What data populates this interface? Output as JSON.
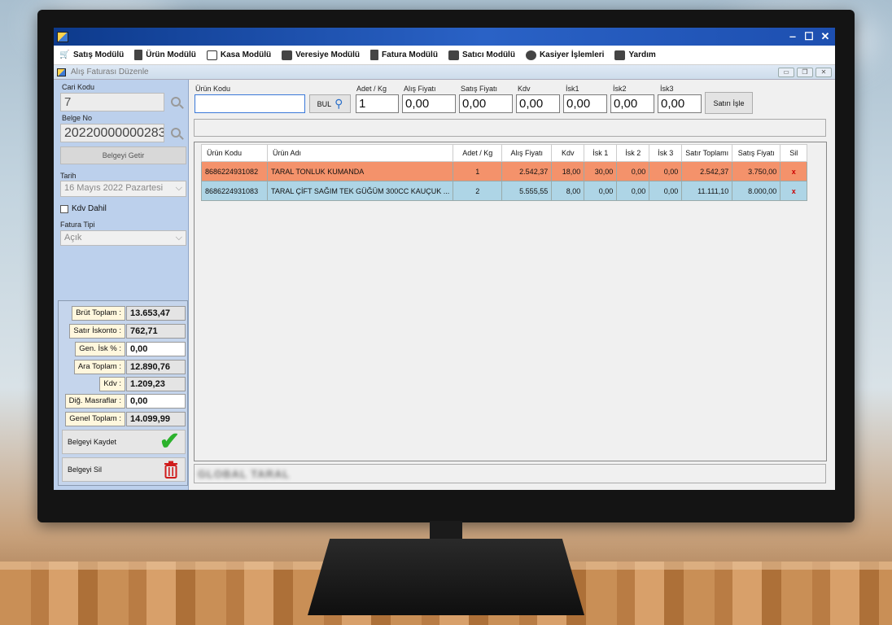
{
  "menu": {
    "items": [
      {
        "label": "Satış Modülü",
        "icon": "cart-icon"
      },
      {
        "label": "Ürün Modülü",
        "icon": "document-icon"
      },
      {
        "label": "Kasa Modülü",
        "icon": "cash-register-icon"
      },
      {
        "label": "Veresiye Modülü",
        "icon": "person-card-icon"
      },
      {
        "label": "Fatura Modülü",
        "icon": "document-icon"
      },
      {
        "label": "Satıcı Modülü",
        "icon": "person-card-icon"
      },
      {
        "label": "Kasiyer İşlemleri",
        "icon": "user-circle-icon"
      },
      {
        "label": "Yardım",
        "icon": "help-icon"
      }
    ]
  },
  "subwindow": {
    "title": "Alış Faturası Düzenle"
  },
  "left": {
    "cari_kodu_label": "Cari Kodu",
    "cari_kodu_value": "7",
    "belge_no_label": "Belge No",
    "belge_no_value": "20220000000283",
    "get_button": "Belgeyi Getir",
    "tarih_label": "Tarih",
    "tarih_value": "16   Mayıs   2022 Pazartesi",
    "kdv_dahil": "Kdv Dahil",
    "fatura_tipi_label": "Fatura Tipi",
    "fatura_tipi_value": "Açık"
  },
  "totals": {
    "brut_label": "Brüt Toplam :",
    "brut_value": "13.653,47",
    "satir_isk_label": "Satır İskonto :",
    "satir_isk_value": "762,71",
    "gen_isk_label": "Gen. İsk % :",
    "gen_isk_value": "0,00",
    "ara_label": "Ara Toplam :",
    "ara_value": "12.890,76",
    "kdv_label": "Kdv :",
    "kdv_value": "1.209,23",
    "dig_label": "Diğ. Masraflar :",
    "dig_value": "0,00",
    "genel_label": "Genel Toplam :",
    "genel_value": "14.099,99",
    "save_button": "Belgeyi Kaydet",
    "delete_button": "Belgeyi Sil"
  },
  "form": {
    "urun_kodu_label": "Ürün Kodu",
    "urun_kodu_value": "",
    "bul_button": "BUL",
    "adet_label": "Adet / Kg",
    "adet_value": "1",
    "alis_label": "Alış Fiyatı",
    "alis_value": "0,00",
    "satis_label": "Satış Fiyatı",
    "satis_value": "0,00",
    "kdv_label": "Kdv",
    "kdv_value": "0,00",
    "isk1_label": "İsk1",
    "isk1_value": "0,00",
    "isk2_label": "İsk2",
    "isk2_value": "0,00",
    "isk3_label": "İsk3",
    "isk3_value": "0,00",
    "satir_isle_button": "Satırı İşle"
  },
  "grid": {
    "headers": [
      "Ürün Kodu",
      "Ürün Adı",
      "Adet / Kg",
      "Alış Fiyatı",
      "Kdv",
      "İsk 1",
      "İsk 2",
      "İsk 3",
      "Satır Toplamı",
      "Satış Fiyatı",
      "Sil"
    ],
    "rows": [
      {
        "kod": "8686224931082",
        "ad": "TARAL TONLUK KUMANDA",
        "adet": "1",
        "alis": "2.542,37",
        "kdv": "18,00",
        "isk1": "30,00",
        "isk2": "0,00",
        "isk3": "0,00",
        "toplam": "2.542,37",
        "satis": "3.750,00",
        "sil": "x"
      },
      {
        "kod": "8686224931083",
        "ad": "TARAL ÇİFT SAĞIM TEK GÜĞÜM 300CC KAUÇUK ...",
        "adet": "2",
        "alis": "5.555,55",
        "kdv": "8,00",
        "isk1": "0,00",
        "isk2": "0,00",
        "isk3": "0,00",
        "toplam": "11.111,10",
        "satis": "8.000,00",
        "sil": "x"
      }
    ]
  },
  "status": {
    "text": "GLOBAL TARAL"
  }
}
